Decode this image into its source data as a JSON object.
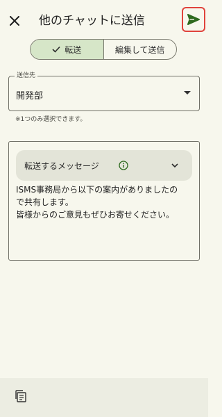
{
  "header": {
    "title": "他のチャットに送信"
  },
  "segments": [
    {
      "label": "転送",
      "selected": true
    },
    {
      "label": "編集して送信",
      "selected": false
    }
  ],
  "destination": {
    "label": "送信先",
    "value": "開発部",
    "helper": "※1つのみ選択できます。"
  },
  "message": {
    "chip_label": "転送するメッセージ",
    "lines": [
      "ISMS事務局から以下の案内がありましたの",
      "で共有します。",
      "皆様からのご意見もぜひお寄せください。"
    ]
  },
  "icons": {
    "close": "close-icon",
    "send": "send-icon",
    "check": "check-icon",
    "info": "info-icon",
    "chevron": "chevron-down-icon",
    "copy": "copy-icon"
  },
  "colors": {
    "background": "#f7f7ed",
    "send_accent": "#2f6a1f",
    "highlight_border": "#e0433c",
    "segment_selected": "#d6e6c8"
  }
}
